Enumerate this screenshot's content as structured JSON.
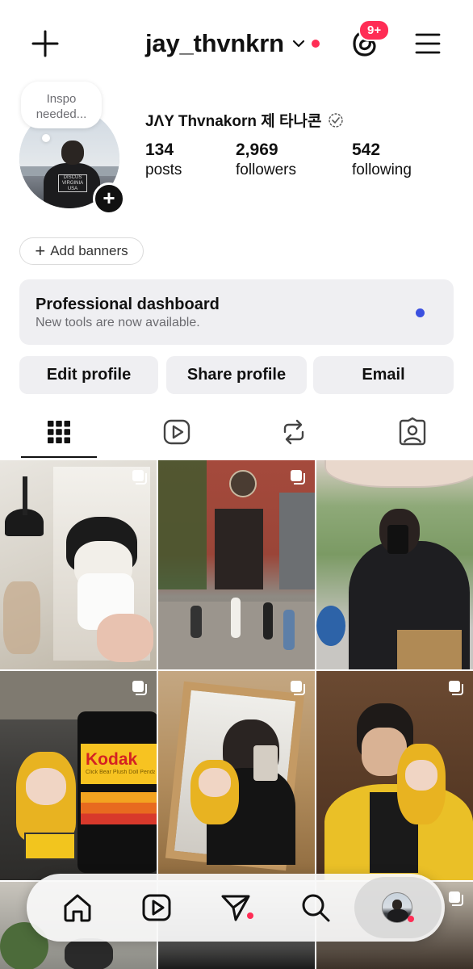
{
  "header": {
    "username": "jay_thvnkrn",
    "notification_badge": "9+",
    "accent_color": "#ff2d55"
  },
  "profile": {
    "note_bubble": "Inspo\nneeded...",
    "full_name": "JΛY Thvnakorn 제 타나콘",
    "stats": [
      {
        "value": "134",
        "label": "posts"
      },
      {
        "value": "2,969",
        "label": "followers"
      },
      {
        "value": "542",
        "label": "following"
      }
    ],
    "add_banners_label": "Add banners"
  },
  "dashboard": {
    "title": "Professional dashboard",
    "subtitle": "New tools are now available.",
    "dot_color": "#3b50e0"
  },
  "actions": {
    "edit_profile": "Edit profile",
    "share_profile": "Share profile",
    "email": "Email"
  },
  "tabs": [
    {
      "name": "grid-icon",
      "selected": true
    },
    {
      "name": "reels-icon",
      "selected": false
    },
    {
      "name": "reposts-icon",
      "selected": false
    },
    {
      "name": "tagged-icon",
      "selected": false
    }
  ],
  "grid": {
    "kodak_text": "Kodak",
    "kodak_sub": "Click Bear Plush Doll Pendant"
  },
  "nav": [
    {
      "name": "home-icon"
    },
    {
      "name": "reels-icon"
    },
    {
      "name": "messages-icon",
      "has_dot": true
    },
    {
      "name": "search-icon"
    },
    {
      "name": "profile-avatar",
      "has_dot": true
    }
  ]
}
